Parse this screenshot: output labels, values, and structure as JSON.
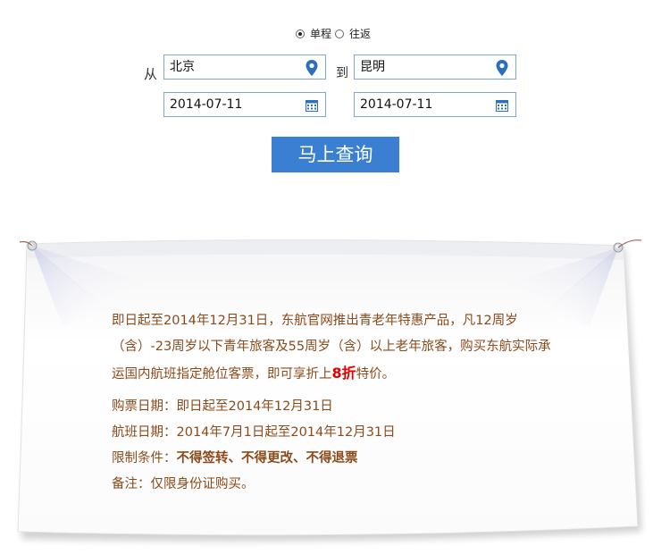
{
  "form": {
    "trip_type": {
      "one_way": "单程",
      "round_trip": "往返",
      "selected": "one_way"
    },
    "from_label": "从",
    "to_label": "到",
    "from_value": "北京",
    "to_value": "昆明",
    "depart_date": "2014-07-11",
    "return_date": "2014-07-11",
    "search_button": "马上查询",
    "icons": {
      "location": "map-pin-icon",
      "calendar": "calendar-icon"
    },
    "colors": {
      "button": "#3b7fd2",
      "field_border": "#7da7d6",
      "icon": "#2c6fbf"
    }
  },
  "notice": {
    "intro_part1": "即日起至2014年12月31日，东航官网推出青老年特惠产品，凡12周岁（含）-23周岁以下青年旅客及55周岁（含）以上老年旅客，购买东航实际承运国内航班指定舱位客票，即可享折上",
    "discount": "8折",
    "intro_part2": "特价。",
    "purchase_label": "购票日期：",
    "purchase_value": "即日起至2014年12月31日",
    "flight_label": "航班日期：",
    "flight_value": "2014年7月1日起至2014年12月31日",
    "restriction_label": "限制条件：",
    "restriction_value": "不得签转、不得更改、不得退票",
    "note_label": "备注：",
    "note_value": "仅限身份证购买。",
    "colors": {
      "text": "#8b4a1a",
      "highlight": "#e00000"
    }
  }
}
